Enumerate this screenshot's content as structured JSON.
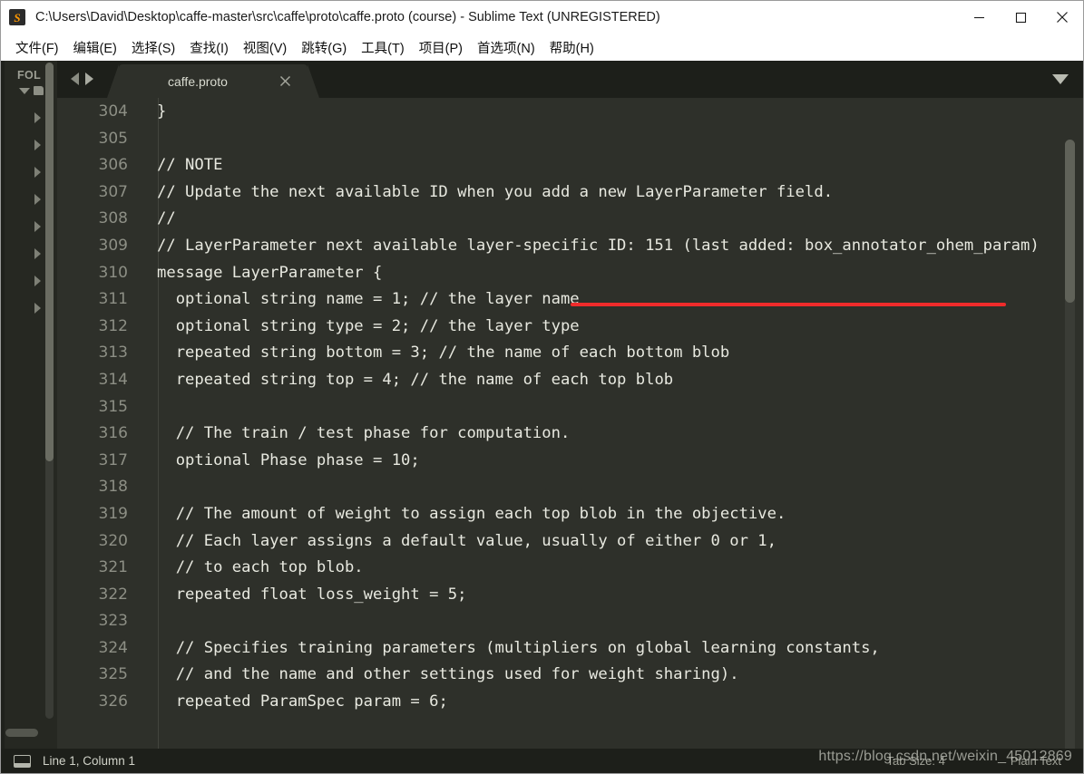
{
  "window": {
    "title": "C:\\Users\\David\\Desktop\\caffe-master\\src\\caffe\\proto\\caffe.proto (course) - Sublime Text (UNREGISTERED)",
    "app_icon": "S",
    "minimize_label": "─",
    "maximize_label": "□",
    "close_label": "✕"
  },
  "menubar": {
    "items": [
      {
        "label": "文件(F)",
        "accel": "F"
      },
      {
        "label": "编辑(E)",
        "accel": "E"
      },
      {
        "label": "选择(S)",
        "accel": "S"
      },
      {
        "label": "查找(I)",
        "accel": "I"
      },
      {
        "label": "视图(V)",
        "accel": "V"
      },
      {
        "label": "跳转(G)",
        "accel": "G"
      },
      {
        "label": "工具(T)",
        "accel": "T"
      },
      {
        "label": "项目(P)",
        "accel": "P"
      },
      {
        "label": "首选项(N)",
        "accel": "N"
      },
      {
        "label": "帮助(H)",
        "accel": "H"
      }
    ]
  },
  "sidebar": {
    "header": "FOL",
    "tree_rows": 9
  },
  "tabbar": {
    "tabs": [
      {
        "label": "caffe.proto",
        "close": "✕",
        "active": true
      }
    ]
  },
  "editor": {
    "lines": [
      {
        "num": "304",
        "text": "}"
      },
      {
        "num": "305",
        "text": ""
      },
      {
        "num": "306",
        "text": "// NOTE"
      },
      {
        "num": "307",
        "text": "// Update the next available ID when you add a new LayerParameter field."
      },
      {
        "num": "308",
        "text": "//"
      },
      {
        "num": "309",
        "text": "// LayerParameter next available layer-specific ID: 151 (last added: box_annotator_ohem_param)"
      },
      {
        "num": "310",
        "text": "message LayerParameter {"
      },
      {
        "num": "311",
        "text": "  optional string name = 1; // the layer name"
      },
      {
        "num": "312",
        "text": "  optional string type = 2; // the layer type"
      },
      {
        "num": "313",
        "text": "  repeated string bottom = 3; // the name of each bottom blob"
      },
      {
        "num": "314",
        "text": "  repeated string top = 4; // the name of each top blob"
      },
      {
        "num": "315",
        "text": ""
      },
      {
        "num": "316",
        "text": "  // The train / test phase for computation."
      },
      {
        "num": "317",
        "text": "  optional Phase phase = 10;"
      },
      {
        "num": "318",
        "text": ""
      },
      {
        "num": "319",
        "text": "  // The amount of weight to assign each top blob in the objective."
      },
      {
        "num": "320",
        "text": "  // Each layer assigns a default value, usually of either 0 or 1,"
      },
      {
        "num": "321",
        "text": "  // to each top blob."
      },
      {
        "num": "322",
        "text": "  repeated float loss_weight = 5;"
      },
      {
        "num": "323",
        "text": ""
      },
      {
        "num": "324",
        "text": "  // Specifies training parameters (multipliers on global learning constants,"
      },
      {
        "num": "325",
        "text": "  // and the name and other settings used for weight sharing)."
      },
      {
        "num": "326",
        "text": "  repeated ParamSpec param = 6;"
      }
    ]
  },
  "statusbar": {
    "cursor_position": "Line 1, Column 1",
    "tab_size": "Tab Size: 4",
    "syntax": "Plain Text"
  },
  "watermark": {
    "text": "https://blog.csdn.net/weixin_45012869"
  },
  "colors": {
    "editor_background": "#2e302a",
    "sidebar_background": "#262822",
    "tabbar_background": "#1d1f1a",
    "code_text": "#e8e9e0",
    "line_number": "#8d8f85",
    "accent_red": "#ef2b2b",
    "app_icon_orange": "#ff9800"
  }
}
